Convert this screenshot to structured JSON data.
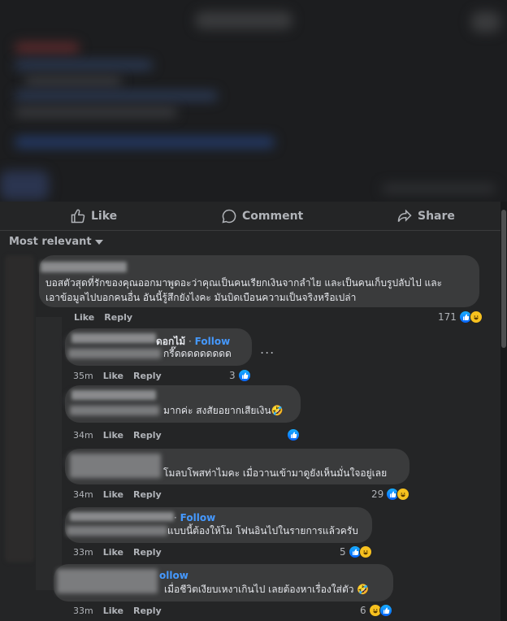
{
  "actions": {
    "like": "Like",
    "comment": "Comment",
    "share": "Share"
  },
  "sort_label": "Most relevant",
  "comments": [
    {
      "text_line1": "บอสตัวสุดที่รักของคุณออกมาพูดอะว่าคุณเป็นคนเรียกเงินจากลำไย และเป็นคนเก็บรูปลับไป และ",
      "text_line2": "เอาข้อมูลไปบอกคนอื่น อันนี้รู้สึกยังไงคะ มันบิดเบือนความเป็นจริงหรือเปล่า",
      "time": "",
      "like": "Like",
      "reply": "Reply",
      "count": "171"
    },
    {
      "name": "ดอกไม้",
      "follow": "Follow",
      "text": "กรี๊ดดดดดดดดด",
      "time": "35m",
      "like": "Like",
      "reply": "Reply",
      "count": "3"
    },
    {
      "text": "มากค่ะ สงสัยอยากเสียเงิน🤣",
      "time": "34m",
      "like": "Like",
      "reply": "Reply",
      "count": ""
    },
    {
      "text": "โมลบโพสท่าไมคะ เมื่อวานเข้ามาดูยังเห็นมั่นใจอยู่เลย",
      "time": "34m",
      "like": "Like",
      "reply": "Reply",
      "count": "29"
    },
    {
      "follow": "Follow",
      "text": "แบบนี้ต้องให้โม โฟนอินไปในรายการแล้วครับ",
      "time": "33m",
      "like": "Like",
      "reply": "Reply",
      "count": "5"
    },
    {
      "follow": "ollow",
      "text": "เมื่อชีวิตเงียบเหงาเกินไป เลยต้องหาเรื่องใส่ตัว 🤣",
      "time": "33m",
      "like": "Like",
      "reply": "Reply",
      "count": "6"
    }
  ],
  "more_label": "..."
}
